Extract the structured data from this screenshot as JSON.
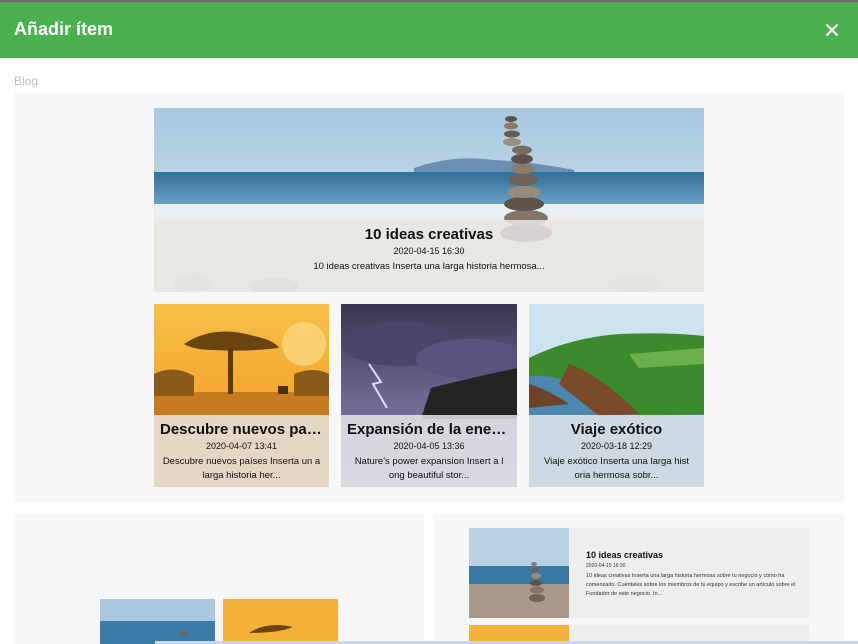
{
  "dialog": {
    "title": "Añadir ítem",
    "close_label": "close"
  },
  "section": {
    "label": "Blog"
  },
  "featured": {
    "title": "10 ideas creativas",
    "date": "2020-04-15 16:30",
    "excerpt": "10 ideas creativas   Inserta una larga historia hermosa..."
  },
  "cards": [
    {
      "title": "Descubre nuevos países",
      "date": "2020-04-07 13:41",
      "excerpt": "Descubre nuevos países   Inserta un a larga historia her..."
    },
    {
      "title": "Expansión de la energí...",
      "date": "2020-04-05 13:36",
      "excerpt": "Nature's power expansion   Insert a l ong beautiful stor..."
    },
    {
      "title": "Viaje exótico",
      "date": "2020-03-18 12:29",
      "excerpt": "Viaje exótico   Inserta una larga hist oria hermosa sobr..."
    }
  ],
  "list_item": {
    "title": "10 ideas creativas",
    "date": "2020-04-15 16:30",
    "excerpt": "10 ideas creativas   Inserta una larga historia hermosa sobre tu negocio y cómo ha comenzado. Cuéntales sobre los miembros de tu equipo y escribe un artículo sobre el Fundador de este negocio. In..."
  },
  "icons": {
    "close": "close-icon"
  },
  "colors": {
    "header": "#4caf50",
    "panel": "#f7f7f7",
    "label": "#bdbdbd"
  }
}
